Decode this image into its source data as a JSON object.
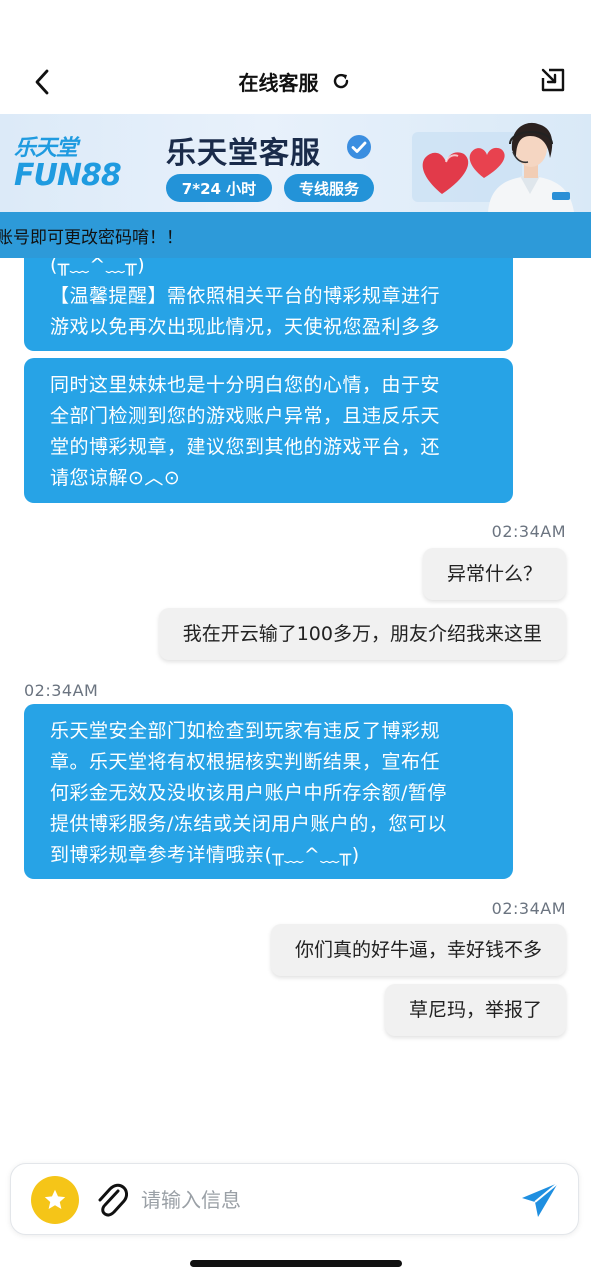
{
  "header": {
    "title": "在线客服",
    "icons": {
      "back": "chevron-left-icon",
      "refresh": "refresh-icon",
      "exit": "exit-icon"
    }
  },
  "banner": {
    "brand_cn": "乐天堂",
    "brand_en": "FUN88",
    "title": "乐天堂客服",
    "pill_hours": "7*24 小时",
    "pill_service": "专线服务",
    "colors": {
      "accent": "#2393d8",
      "background": "#dceaf8"
    }
  },
  "notice": {
    "text": "账号即可更改密码唷！！"
  },
  "messages": [
    {
      "from": "agent",
      "time": "",
      "text_lines": [
        "(╥﹏^﹏╥)",
        "【温馨提醒】需依照相关平台的博彩规章进行",
        "游戏以免再次出现此情况，天使祝您盈利多多"
      ]
    },
    {
      "from": "agent",
      "time": "",
      "text_lines": [
        "同时这里妹妹也是十分明白您的心情，由于安",
        "全部门检测到您的游戏账户异常，且违反乐天",
        "堂的博彩规章，建议您到其他的游戏平台，还",
        "请您谅解⊙︿⊙"
      ]
    },
    {
      "from": "user",
      "time": "02:34AM",
      "text": "异常什么？"
    },
    {
      "from": "user",
      "time": "",
      "text": "我在开云输了100多万，朋友介绍我来这里"
    },
    {
      "from": "agent",
      "time": "02:34AM",
      "text_lines": [
        "乐天堂安全部门如检查到玩家有违反了博彩规",
        "章。乐天堂将有权根据核实判断结果，宣布任",
        "何彩金无效及没收该用户账户中所存余额/暂停",
        "提供博彩服务/冻结或关闭用户账户的，您可以",
        "到博彩规章参考详情哦亲(╥﹏^﹏╥)"
      ]
    },
    {
      "from": "user",
      "time": "02:34AM",
      "text": "你们真的好牛逼，幸好钱不多"
    },
    {
      "from": "user",
      "time": "",
      "text": "草尼玛，举报了"
    }
  ],
  "input": {
    "placeholder": "请输入信息",
    "value": "",
    "icons": {
      "emoji": "star-icon",
      "attach": "paperclip-icon",
      "send": "send-icon"
    }
  },
  "colors": {
    "agent_bubble": "#27a3e6",
    "user_bubble": "#f1f1f1",
    "notice_bar": "#2d9ad9",
    "star_button": "#f5c518",
    "send_icon": "#1f8fe0"
  }
}
